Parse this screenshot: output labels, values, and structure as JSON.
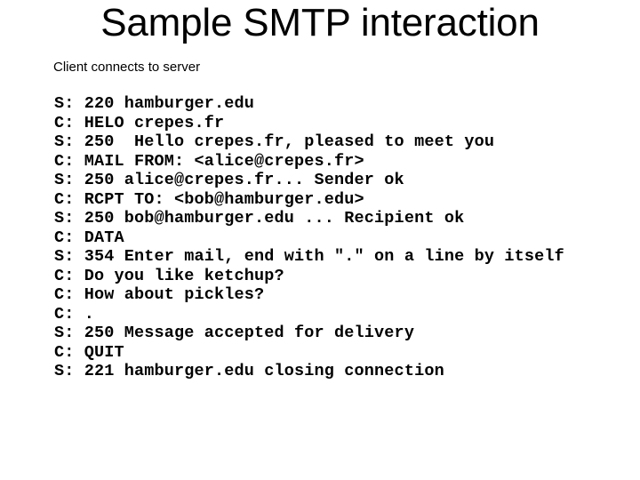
{
  "slide": {
    "title": "Sample SMTP interaction",
    "subtitle": "Client connects to server",
    "background_color": "#ffffff",
    "text_color": "#000000"
  },
  "transcript": {
    "lines": [
      {
        "role": "S",
        "text": "S: 220 hamburger.edu"
      },
      {
        "role": "C",
        "text": "C: HELO crepes.fr"
      },
      {
        "role": "S",
        "text": "S: 250  Hello crepes.fr, pleased to meet you"
      },
      {
        "role": "C",
        "text": "C: MAIL FROM: <alice@crepes.fr>"
      },
      {
        "role": "S",
        "text": "S: 250 alice@crepes.fr... Sender ok"
      },
      {
        "role": "C",
        "text": "C: RCPT TO: <bob@hamburger.edu>"
      },
      {
        "role": "S",
        "text": "S: 250 bob@hamburger.edu ... Recipient ok"
      },
      {
        "role": "C",
        "text": "C: DATA"
      },
      {
        "role": "S",
        "text": "S: 354 Enter mail, end with \".\" on a line by itself"
      },
      {
        "role": "C",
        "text": "C: Do you like ketchup?"
      },
      {
        "role": "C",
        "text": "C: How about pickles?"
      },
      {
        "role": "C",
        "text": "C: ."
      },
      {
        "role": "S",
        "text": "S: 250 Message accepted for delivery"
      },
      {
        "role": "C",
        "text": "C: QUIT"
      },
      {
        "role": "S",
        "text": "S: 221 hamburger.edu closing connection"
      }
    ]
  }
}
